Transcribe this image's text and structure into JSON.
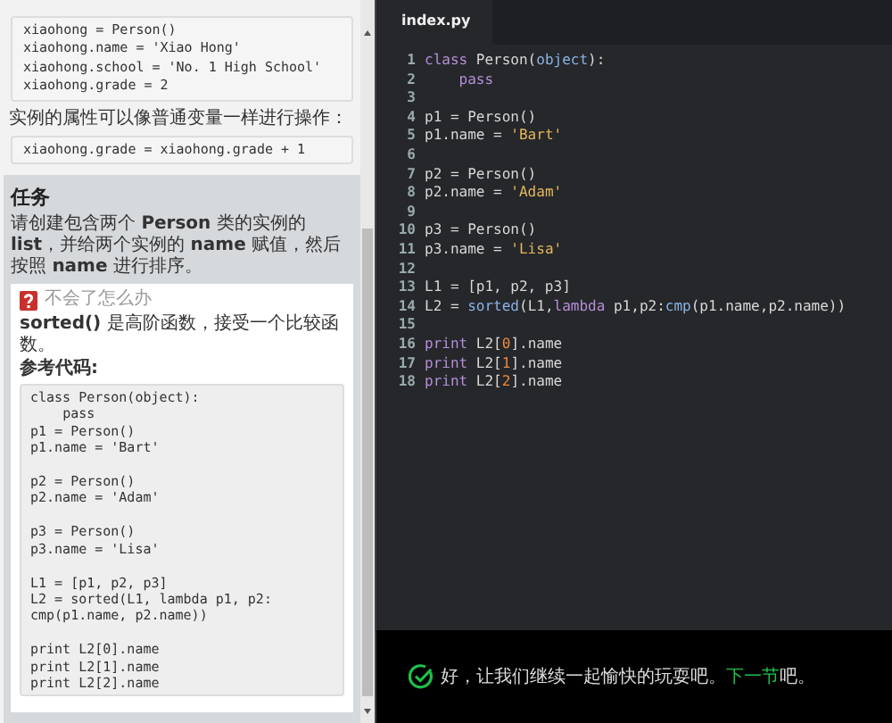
{
  "lesson": {
    "code_1": [
      "xiaohong = Person()",
      "xiaohong.name = 'Xiao Hong'",
      "xiaohong.school = 'No. 1 High School'",
      "xiaohong.grade = 2"
    ],
    "note": "实例的属性可以像普通变量一样进行操作：",
    "code_2": [
      "xiaohong.grade = xiaohong.grade + 1"
    ]
  },
  "task": {
    "title": "任务",
    "description": "请创建包含两个 **Person** 类的实例的 **list**，并给两个实例的 **name** 赋值，然后按照 **name** 进行排序。",
    "hint": {
      "title": "不会了怎么办",
      "text": "**sorted()** 是高阶函数，接受一个比较函数。",
      "code_label": "参考代码:",
      "code_blocks": [
        [
          "class Person(object):",
          "    pass",
          "p1 = Person()",
          "p1.name = 'Bart'"
        ],
        [
          "p2 = Person()",
          "p2.name = 'Adam'"
        ],
        [
          "p3 = Person()",
          "p3.name = 'Lisa'"
        ],
        [
          "L1 = [p1, p2, p3]",
          "L2 = sorted(L1, lambda p1, p2:",
          "cmp(p1.name, p2.name))"
        ],
        [
          "print L2[0].name",
          "print L2[1].name",
          "print L2[2].name"
        ]
      ]
    }
  },
  "editor": {
    "tabs": [
      {
        "label": "index.py",
        "selected": true
      }
    ],
    "lines": [
      {
        "number": "1",
        "tokens": [
          {
            "text": "class ",
            "kind": "keyword"
          },
          {
            "text": "Person(",
            "kind": "plain"
          },
          {
            "text": "object",
            "kind": "builtin"
          },
          {
            "text": "):",
            "kind": "plain"
          }
        ]
      },
      {
        "number": "2",
        "tokens": [
          {
            "text": "    pass",
            "kind": "keyword"
          }
        ]
      },
      {
        "number": "3"
      },
      {
        "number": "4",
        "tokens": [
          {
            "text": "p1 = Person()",
            "kind": "plain"
          }
        ]
      },
      {
        "number": "5",
        "tokens": [
          {
            "text": "p1.name = ",
            "kind": "plain"
          },
          {
            "text": "'Bart'",
            "kind": "string"
          }
        ]
      },
      {
        "number": "6"
      },
      {
        "number": "7",
        "tokens": [
          {
            "text": "p2 = Person()",
            "kind": "plain"
          }
        ]
      },
      {
        "number": "8",
        "tokens": [
          {
            "text": "p2.name = ",
            "kind": "plain"
          },
          {
            "text": "'Adam'",
            "kind": "string"
          }
        ]
      },
      {
        "number": "9"
      },
      {
        "number": "10",
        "tokens": [
          {
            "text": "p3 = Person()",
            "kind": "plain"
          }
        ]
      },
      {
        "number": "11",
        "tokens": [
          {
            "text": "p3.name = ",
            "kind": "plain"
          },
          {
            "text": "'Lisa'",
            "kind": "string"
          }
        ]
      },
      {
        "number": "12"
      },
      {
        "number": "13",
        "tokens": [
          {
            "text": "L1 = [p1, p2, p3]",
            "kind": "plain"
          }
        ]
      },
      {
        "number": "14",
        "tokens": [
          {
            "text": "L2 = ",
            "kind": "plain"
          },
          {
            "text": "sorted",
            "kind": "builtin"
          },
          {
            "text": "(L1,",
            "kind": "plain"
          },
          {
            "text": "lambda",
            "kind": "keyword"
          },
          {
            "text": " p1,p2:",
            "kind": "plain"
          },
          {
            "text": "cmp",
            "kind": "builtin"
          },
          {
            "text": "(p1.name,p2.name))",
            "kind": "plain"
          }
        ]
      },
      {
        "number": "15"
      },
      {
        "number": "16",
        "tokens": [
          {
            "text": "print",
            "kind": "keyword"
          },
          {
            "text": " L2[",
            "kind": "plain"
          },
          {
            "text": "0",
            "kind": "number"
          },
          {
            "text": "].name",
            "kind": "plain"
          }
        ]
      },
      {
        "number": "17",
        "tokens": [
          {
            "text": "print",
            "kind": "keyword"
          },
          {
            "text": " L2[",
            "kind": "plain"
          },
          {
            "text": "1",
            "kind": "number"
          },
          {
            "text": "].name",
            "kind": "plain"
          }
        ]
      },
      {
        "number": "18",
        "tokens": [
          {
            "text": "print",
            "kind": "keyword"
          },
          {
            "text": " L2[",
            "kind": "plain"
          },
          {
            "text": "2",
            "kind": "number"
          },
          {
            "text": "].name",
            "kind": "plain"
          }
        ]
      }
    ]
  },
  "result": {
    "message": "好，让我们继续一起愉快的玩耍吧。",
    "link": "下一节",
    "tail": "吧。"
  }
}
